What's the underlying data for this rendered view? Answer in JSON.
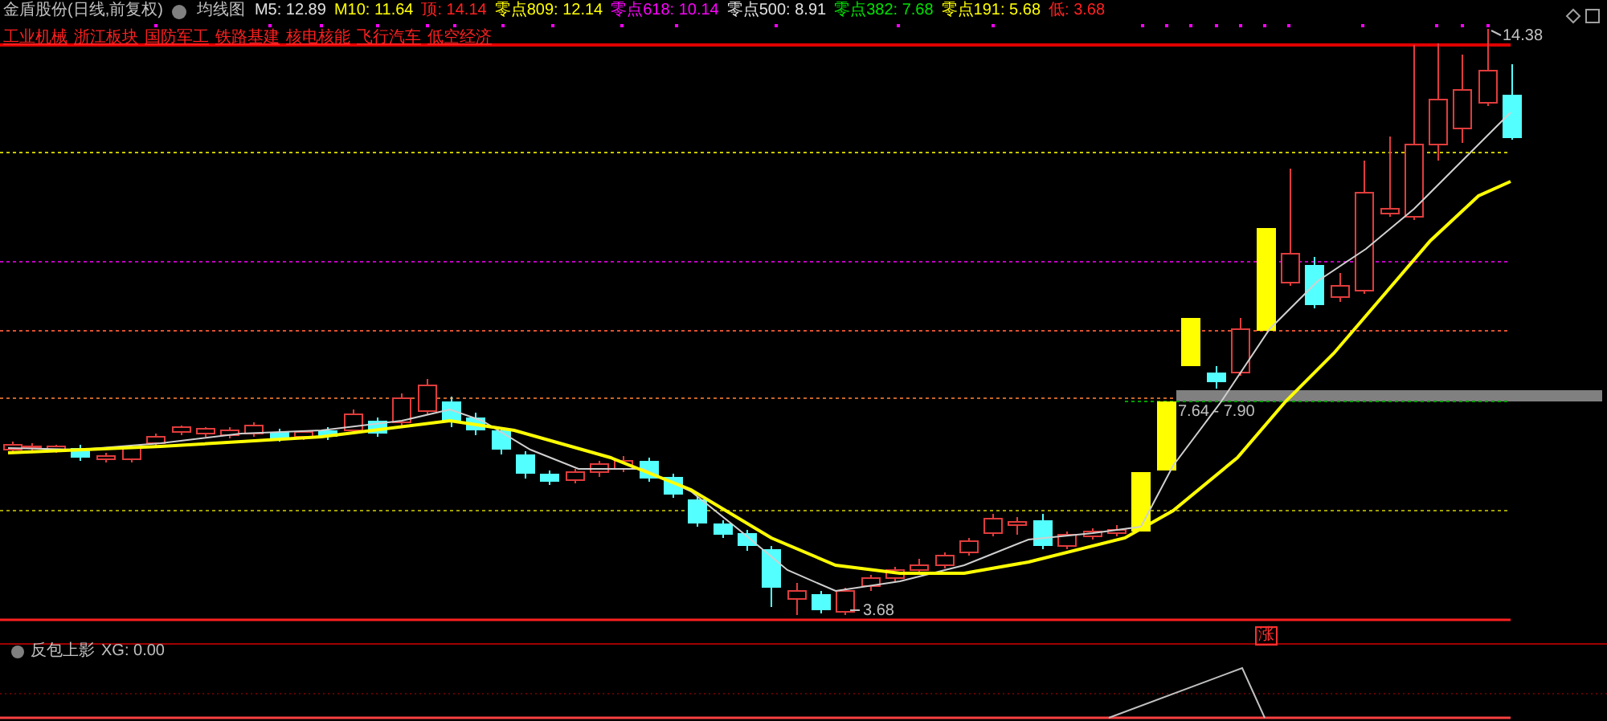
{
  "header": {
    "stock": "金盾股份(日线,前复权)",
    "indicator": "均线图"
  },
  "values": [
    {
      "label": "M5: 12.89",
      "color": "#e0e0e0"
    },
    {
      "label": "M10: 11.64",
      "color": "#ffff00"
    },
    {
      "label": "顶: 14.14",
      "color": "#ff2020"
    },
    {
      "label": "零点809: 12.14",
      "color": "#ffff00"
    },
    {
      "label": "零点618: 10.14",
      "color": "#ff00ff"
    },
    {
      "label": "零点500: 8.91",
      "color": "#e0e0e0"
    },
    {
      "label": "零点382: 7.68",
      "color": "#00e000"
    },
    {
      "label": "零点191: 5.68",
      "color": "#ffff00"
    },
    {
      "label": "低: 3.68",
      "color": "#ff2020"
    }
  ],
  "sectors": [
    "工业机械",
    "浙江板块",
    "国防军工",
    "铁路基建",
    "核电核能",
    "飞行汽车",
    "低空经济"
  ],
  "chart": {
    "high_label": "14.38",
    "low_label": "3.68",
    "zone_label": "7.64 - 7.90",
    "signal_tag": "涨"
  },
  "lower_pane": {
    "title": "反包上影",
    "reading": "XG: 0.00"
  }
}
